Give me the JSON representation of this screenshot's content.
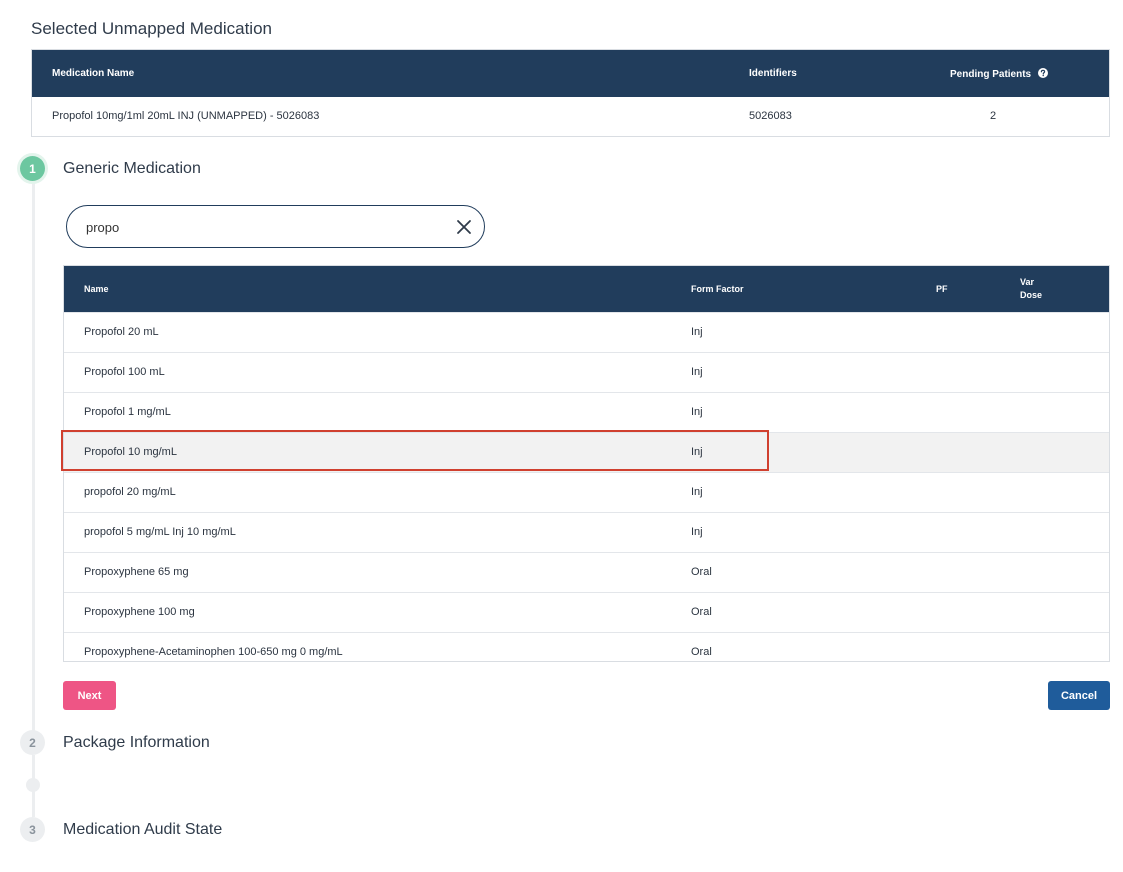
{
  "page": {
    "title": "Selected Unmapped Medication"
  },
  "selected_medication": {
    "headers": {
      "name": "Medication Name",
      "identifiers": "Identifiers",
      "pending": "Pending Patients"
    },
    "row": {
      "name": "Propofol 10mg/1ml 20mL INJ (UNMAPPED) - 5026083",
      "identifiers": "5026083",
      "pending": "2"
    }
  },
  "steps": [
    {
      "number": "1",
      "title": "Generic Medication"
    },
    {
      "number": "2",
      "title": "Package Information"
    },
    {
      "number": "3",
      "title": "Medication Audit State"
    }
  ],
  "search": {
    "value": "propo",
    "placeholder": ""
  },
  "results": {
    "headers": {
      "name": "Name",
      "form": "Form Factor",
      "pf": "PF",
      "var_dose_1": "Var",
      "var_dose_2": "Dose"
    },
    "rows": [
      {
        "name": "Propofol 20 mL",
        "form": "Inj"
      },
      {
        "name": "Propofol 100 mL",
        "form": "Inj"
      },
      {
        "name": "Propofol 1 mg/mL",
        "form": "Inj"
      },
      {
        "name": "Propofol 10 mg/mL",
        "form": "Inj",
        "selected": true
      },
      {
        "name": "propofol 20 mg/mL",
        "form": "Inj"
      },
      {
        "name": "propofol 5 mg/mL Inj 10 mg/mL",
        "form": "Inj"
      },
      {
        "name": "Propoxyphene 65 mg",
        "form": "Oral"
      },
      {
        "name": "Propoxyphene 100 mg",
        "form": "Oral"
      },
      {
        "name": "Propoxyphene-Acetaminophen 100-650 mg 0 mg/mL",
        "form": "Oral"
      }
    ]
  },
  "buttons": {
    "next": "Next",
    "cancel": "Cancel"
  },
  "colors": {
    "header_bg": "#213d5c",
    "step_active": "#6cc7a0",
    "next_button": "#ee5585",
    "cancel_button": "#1f5c9b",
    "selection_outline": "#d0402f"
  },
  "icons": {
    "clear": "close-icon",
    "help": "question-circle-icon"
  }
}
